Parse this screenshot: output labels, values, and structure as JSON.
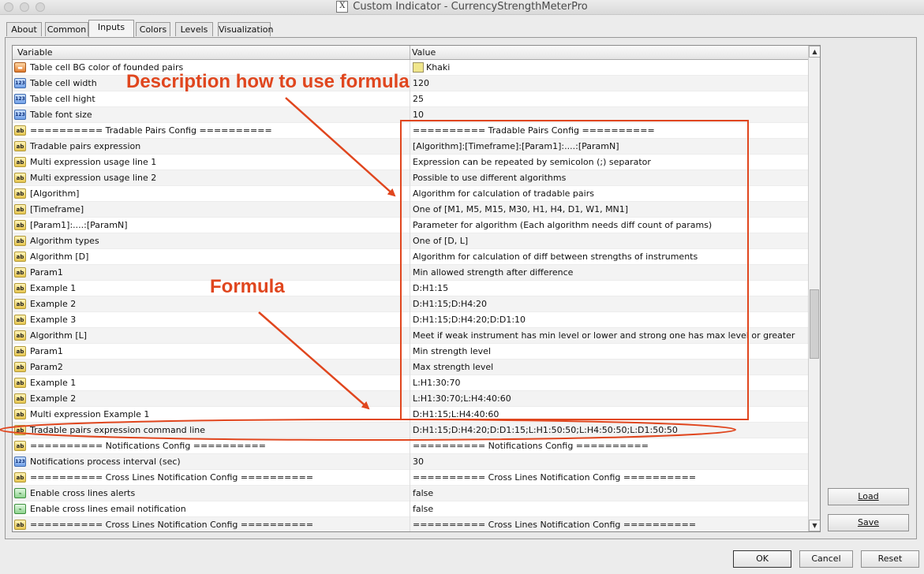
{
  "window": {
    "title": "Custom Indicator - CurrencyStrengthMeterPro",
    "app_icon_glyph": "X"
  },
  "tabs": [
    "About",
    "Common",
    "Inputs",
    "Colors",
    "Levels",
    "Visualization"
  ],
  "active_tab": "Inputs",
  "grid": {
    "col_variable": "Variable",
    "col_value": "Value",
    "rows": [
      {
        "icon": "color",
        "variable": "Table cell BG color of founded pairs",
        "value": "Khaki",
        "swatch": "#F0E68C"
      },
      {
        "icon": "n123",
        "variable": "Table cell width",
        "value": "120"
      },
      {
        "icon": "n123",
        "variable": "Table cell hight",
        "value": "25"
      },
      {
        "icon": "n123",
        "variable": "Table font size",
        "value": "10"
      },
      {
        "icon": "ab",
        "variable": "========== Tradable Pairs Config ==========",
        "value": "========== Tradable Pairs Config =========="
      },
      {
        "icon": "ab",
        "variable": "Tradable pairs expression",
        "value": "[Algorithm]:[Timeframe]:[Param1]:....:[ParamN]"
      },
      {
        "icon": "ab",
        "variable": "Multi expression usage line 1",
        "value": "Expression can be repeated by semicolon (;) separator"
      },
      {
        "icon": "ab",
        "variable": "Multi expression usage line 2",
        "value": "Possible to use different algorithms"
      },
      {
        "icon": "ab",
        "variable": "[Algorithm]",
        "value": "Algorithm for calculation of tradable pairs"
      },
      {
        "icon": "ab",
        "variable": "[Timeframe]",
        "value": "One of [M1, M5, M15, M30, H1, H4, D1, W1, MN1]"
      },
      {
        "icon": "ab",
        "variable": "[Param1]:....:[ParamN]",
        "value": "Parameter for algorithm (Each algorithm needs diff count of params)"
      },
      {
        "icon": "ab",
        "variable": "Algorithm types",
        "value": "One of [D, L]"
      },
      {
        "icon": "ab",
        "variable": "Algorithm [D]",
        "value": "Algorithm for calculation of diff between strengths of instruments"
      },
      {
        "icon": "ab",
        "variable": "Param1",
        "value": "Min allowed strength after difference"
      },
      {
        "icon": "ab",
        "variable": "Example 1",
        "value": "D:H1:15"
      },
      {
        "icon": "ab",
        "variable": "Example 2",
        "value": "D:H1:15;D:H4:20"
      },
      {
        "icon": "ab",
        "variable": "Example 3",
        "value": "D:H1:15;D:H4:20;D:D1:10"
      },
      {
        "icon": "ab",
        "variable": "Algorithm [L]",
        "value": "Meet if weak instrument has min level or lower and strong one has max level or greater"
      },
      {
        "icon": "ab",
        "variable": "Param1",
        "value": "Min strength level"
      },
      {
        "icon": "ab",
        "variable": "Param2",
        "value": "Max strength level"
      },
      {
        "icon": "ab",
        "variable": "Example 1",
        "value": "L:H1:30:70"
      },
      {
        "icon": "ab",
        "variable": "Example 2",
        "value": "L:H1:30:70;L:H4:40:60"
      },
      {
        "icon": "ab",
        "variable": "Multi expression Example 1",
        "value": "D:H1:15;L:H4:40:60"
      },
      {
        "icon": "ab",
        "variable": "Tradable pairs expression command line",
        "value": "D:H1:15;D:H4:20;D:D1:15;L:H1:50:50;L:H4:50:50;L:D1:50:50"
      },
      {
        "icon": "ab",
        "variable": "========== Notifications Config ==========",
        "value": "========== Notifications Config =========="
      },
      {
        "icon": "n123",
        "variable": "Notifications process interval (sec)",
        "value": "30"
      },
      {
        "icon": "ab",
        "variable": "========== Cross Lines Notification Config ==========",
        "value": "========== Cross Lines Notification Config =========="
      },
      {
        "icon": "bool",
        "variable": "Enable cross lines alerts",
        "value": "false"
      },
      {
        "icon": "bool",
        "variable": "Enable cross lines email notification",
        "value": "false"
      },
      {
        "icon": "ab",
        "variable": "========== Cross Lines Notification Config ==========",
        "value": "========== Cross Lines Notification Config =========="
      }
    ]
  },
  "icon_glyphs": {
    "ab": "ab",
    "n123": "123",
    "color": "▬",
    "bool": "⌁"
  },
  "icon_names": {
    "ab": "string-type-icon",
    "n123": "number-type-icon",
    "color": "color-type-icon",
    "bool": "boolean-type-icon"
  },
  "side_buttons": {
    "load": "Load",
    "save": "Save"
  },
  "footer_buttons": {
    "ok": "OK",
    "cancel": "Cancel",
    "reset": "Reset"
  },
  "annotations": {
    "description": "Description how to use formula",
    "formula": "Formula",
    "color": "#e0461e"
  }
}
